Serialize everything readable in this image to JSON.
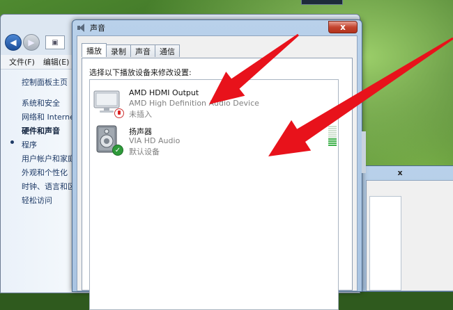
{
  "control_panel": {
    "menu": [
      "文件(F)",
      "编辑(E)"
    ],
    "sidebar_links": [
      "控制面板主页",
      "系统和安全",
      "网络和 Internet",
      "硬件和声音",
      "程序",
      "用户帐户和家庭安全",
      "外观和个性化",
      "时钟、语言和区域",
      "轻松访问"
    ],
    "active_link": "硬件和声音"
  },
  "dialog": {
    "title": "声音",
    "close": "x",
    "tabs": [
      "播放",
      "录制",
      "声音",
      "通信"
    ],
    "active_tab": "播放",
    "instruction": "选择以下播放设备来修改设置:",
    "devices": [
      {
        "name": "AMD HDMI Output",
        "driver": "AMD High Definition Audio Device",
        "status": "未插入",
        "icon": "monitor-icon",
        "badge": "unplugged-badge-icon"
      },
      {
        "name": "扬声器",
        "driver": "VIA HD Audio",
        "status": "默认设备",
        "icon": "speaker-icon",
        "badge": "default-check-icon",
        "level": 0.35
      }
    ]
  },
  "second_window": {
    "close": "x"
  },
  "colors": {
    "arrow": "#e8121b",
    "accent": "#3db04a"
  }
}
